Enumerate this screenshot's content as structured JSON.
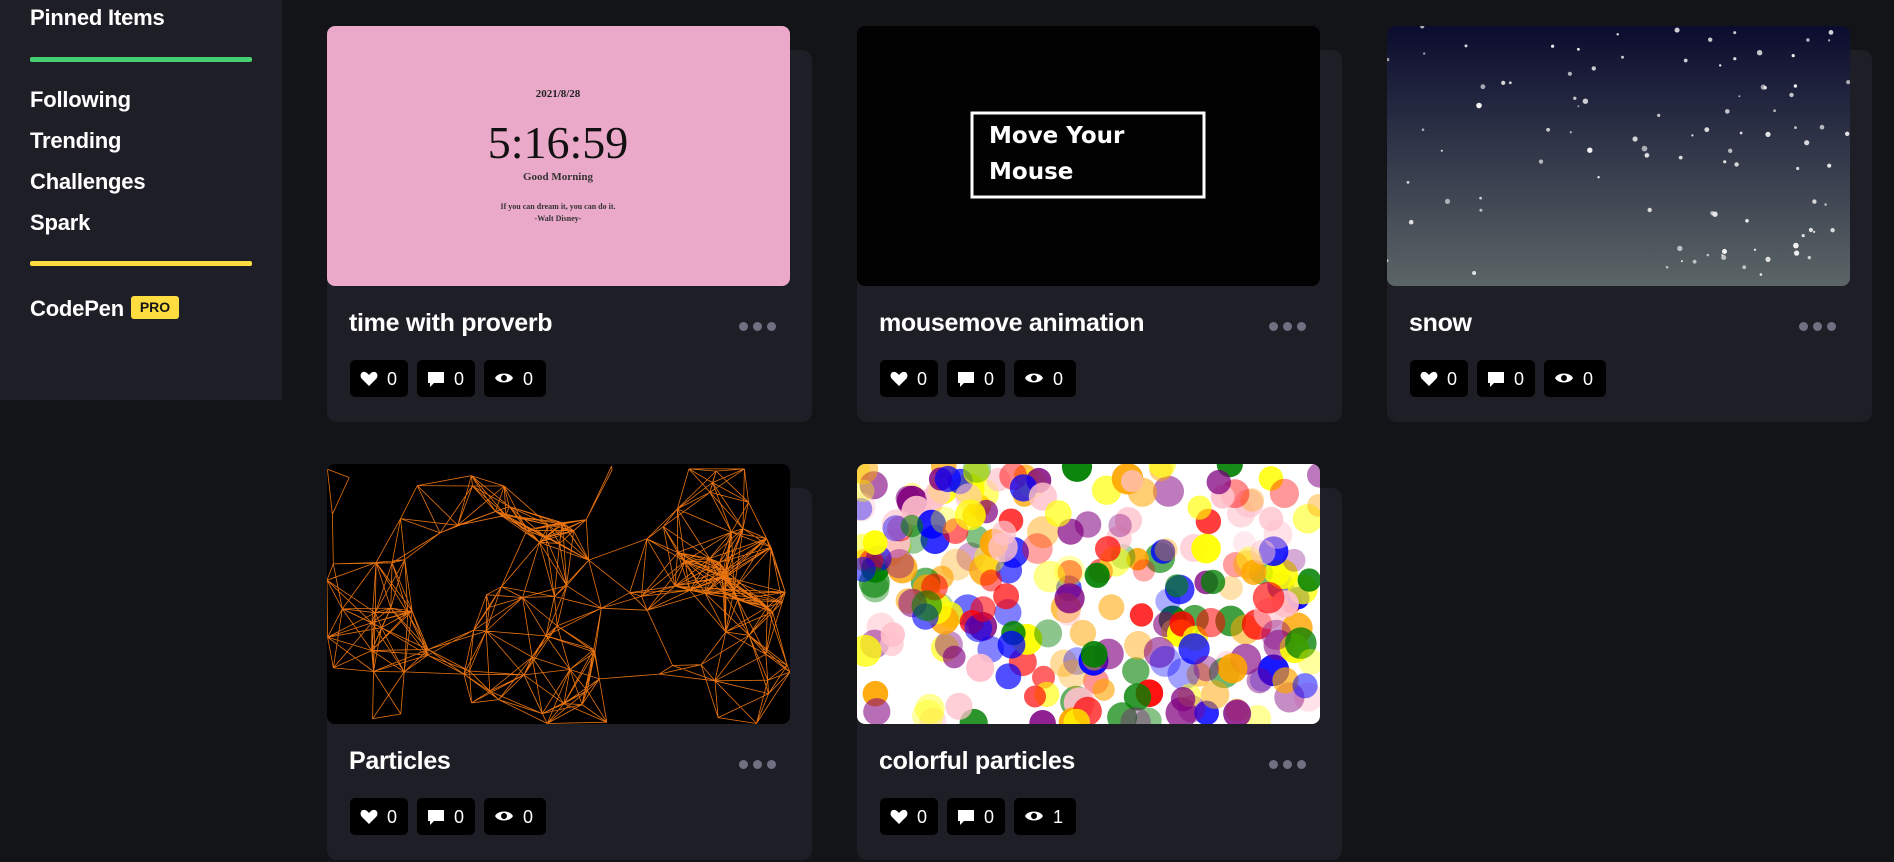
{
  "sidebar": {
    "pinned_label": "Pinned Items",
    "items": [
      {
        "label": "Following"
      },
      {
        "label": "Trending"
      },
      {
        "label": "Challenges"
      },
      {
        "label": "Spark"
      }
    ],
    "codepen_label": "CodePen",
    "pro_label": "PRO",
    "colors": {
      "green_bar": "#47cf73",
      "yellow_bar": "#ffdd40"
    }
  },
  "pens": [
    {
      "title": "time with proverb",
      "likes": "0",
      "comments": "0",
      "views": "0",
      "preview": {
        "date": "2021/8/28",
        "time": "5:16:59",
        "greeting": "Good Morning",
        "quote": "If you can dream it, you can do it.",
        "author": "-Walt Disney-"
      }
    },
    {
      "title": "mousemove animation",
      "likes": "0",
      "comments": "0",
      "views": "0",
      "preview": {
        "line1": "Move Your",
        "line2": "Mouse"
      }
    },
    {
      "title": "snow",
      "likes": "0",
      "comments": "0",
      "views": "0"
    },
    {
      "title": "Particles",
      "likes": "0",
      "comments": "0",
      "views": "0"
    },
    {
      "title": "colorful particles",
      "likes": "0",
      "comments": "0",
      "views": "1"
    }
  ],
  "icons": {
    "like": "heart-icon",
    "comment": "comment-icon",
    "view": "eye-icon",
    "more": "more-dots-icon"
  }
}
